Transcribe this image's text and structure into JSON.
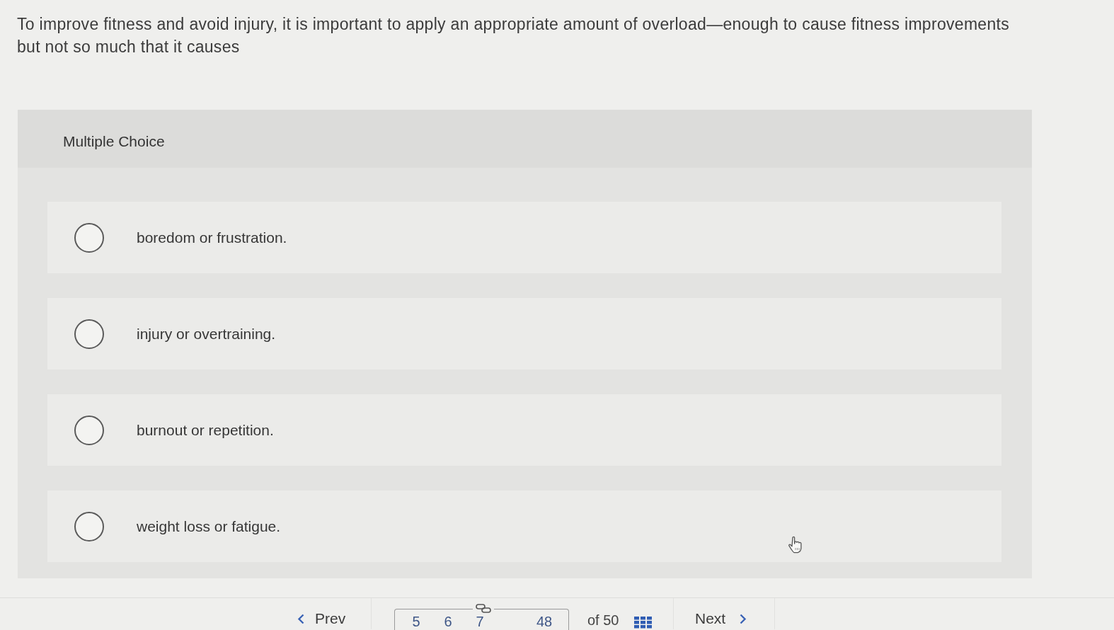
{
  "question": {
    "text": "To improve fitness and avoid injury, it is important to apply an appropriate amount of overload—enough to cause fitness improvements but not so much that it causes"
  },
  "answer_panel": {
    "title": "Multiple Choice",
    "options": [
      {
        "label": "boredom or frustration.",
        "selected": false
      },
      {
        "label": "injury or overtraining.",
        "selected": false
      },
      {
        "label": "burnout or repetition.",
        "selected": false
      },
      {
        "label": "weight loss or fatigue.",
        "selected": false
      }
    ]
  },
  "navigation": {
    "prev": "Prev",
    "pages": [
      "5",
      "6",
      "7",
      "48"
    ],
    "total": "of 50",
    "next": "Next"
  }
}
